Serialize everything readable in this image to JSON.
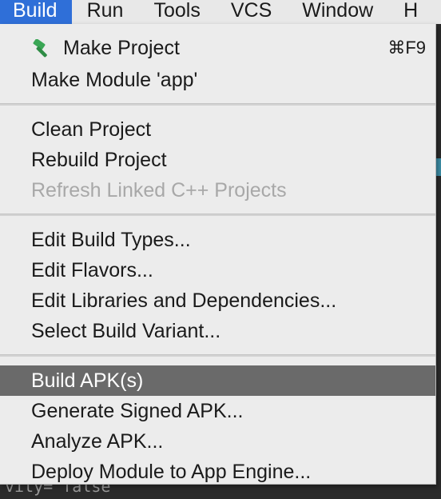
{
  "menubar": {
    "items": [
      {
        "label": "Build",
        "active": true
      },
      {
        "label": "Run"
      },
      {
        "label": "Tools"
      },
      {
        "label": "VCS"
      },
      {
        "label": "Window"
      },
      {
        "label": "H"
      }
    ]
  },
  "build_menu": {
    "make_project": {
      "label": "Make Project",
      "shortcut": "⌘F9",
      "icon": "hammer-icon"
    },
    "make_module": {
      "label": "Make Module 'app'"
    },
    "clean_project": {
      "label": "Clean Project"
    },
    "rebuild_project": {
      "label": "Rebuild Project"
    },
    "refresh_cpp": {
      "label": "Refresh Linked C++ Projects",
      "enabled": false
    },
    "edit_build_types": {
      "label": "Edit Build Types..."
    },
    "edit_flavors": {
      "label": "Edit Flavors..."
    },
    "edit_libraries": {
      "label": "Edit Libraries and Dependencies..."
    },
    "select_variant": {
      "label": "Select Build Variant..."
    },
    "build_apk": {
      "label": "Build APK(s)",
      "highlighted": true
    },
    "generate_signed": {
      "label": "Generate Signed APK..."
    },
    "analyze_apk": {
      "label": "Analyze APK..."
    },
    "deploy_module": {
      "label": "Deploy Module to App Engine..."
    }
  },
  "background": {
    "code_fragment": "vity=\"false\""
  },
  "colors": {
    "menubar_bg": "#e8e8e8",
    "active_menu_bg": "#2f6fd8",
    "dropdown_bg": "#ececec",
    "highlight_bg": "#6a6a6a",
    "disabled_text": "#a8a8a8",
    "hammer_green": "#3aa655"
  }
}
